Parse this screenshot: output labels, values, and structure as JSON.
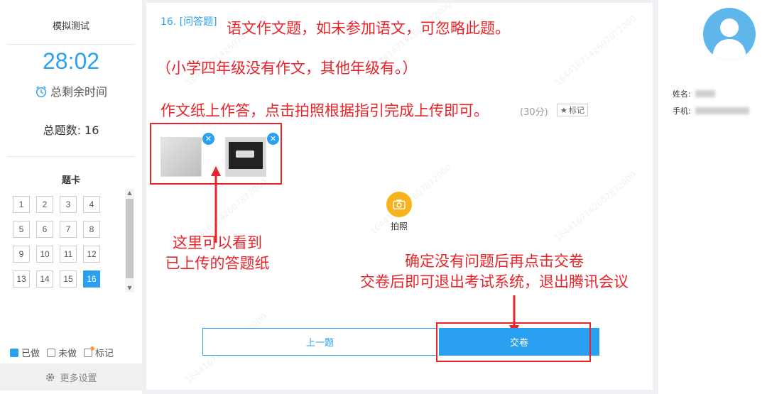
{
  "left": {
    "exam_title": "模拟测试",
    "timer": "28:02",
    "remaining_label": "总剩余时间",
    "total_label": "总题数: 16",
    "card_title": "题卡",
    "cells": [
      "1",
      "2",
      "3",
      "4",
      "5",
      "6",
      "7",
      "8",
      "9",
      "10",
      "11",
      "12",
      "13",
      "14",
      "15",
      "16"
    ],
    "active_cell": "16",
    "legend": {
      "done": "已做",
      "undone": "未做",
      "marked": "标记"
    },
    "more_settings": "更多设置"
  },
  "main": {
    "question_number": "16. [问答题]",
    "note_line1": "语文作文题，如未参加语文，可忽略此题。",
    "note_line2": "（小学四年级没有作文，其他年级有。）",
    "note_line3": "作文纸上作答，点击拍照根据指引完成上传即可。",
    "score": "(30分)",
    "mark_button": "标记",
    "camera_label": "拍照",
    "arrow_note": "这里可以看到\n已上传的答题纸",
    "submit_note_line1": "确定没有问题后再点击交卷",
    "submit_note_line2": "交卷后即可退出考试系统，退出腾讯会议",
    "prev_button": "上一题",
    "submit_button": "交卷",
    "watermark": "1644167142607872000"
  },
  "right": {
    "name_label": "姓名:",
    "phone_label": "手机:"
  },
  "colors": {
    "accent": "#2aa1f0",
    "annotation": "#e8242a",
    "camera": "#f7b31e"
  }
}
